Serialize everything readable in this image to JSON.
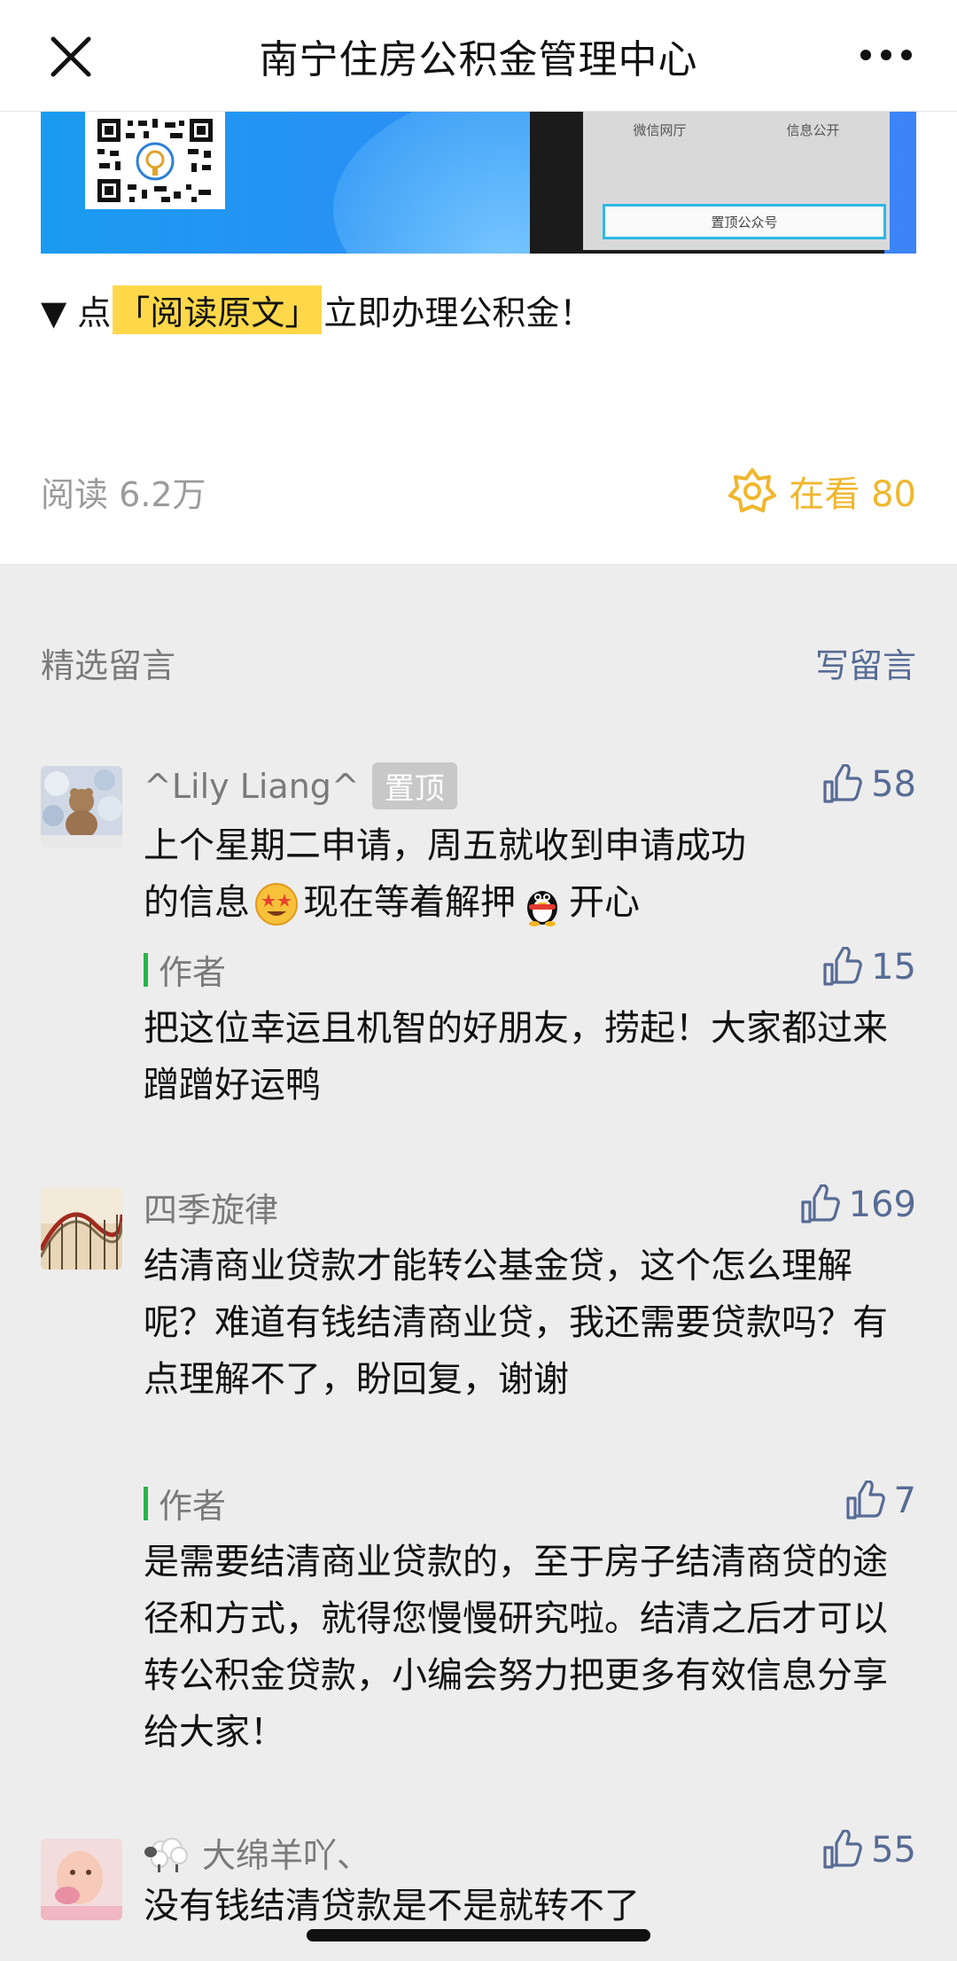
{
  "navbar": {
    "title": "南宁住房公积金管理中心",
    "close_icon": "close-icon",
    "more_icon": "more-dots-icon"
  },
  "banner": {
    "phone_tab_1": "微信网厅",
    "phone_tab_2": "信息公开",
    "phone_button": "置顶公众号"
  },
  "article": {
    "read_prefix": "▼ 点",
    "read_link": "「阅读原文」",
    "read_suffix": "立即办理公积金！",
    "read_count": "阅读 6.2万",
    "looking_label": "在看 80"
  },
  "comments_header": {
    "title": "精选留言",
    "write": "写留言"
  },
  "comments": [
    {
      "name": "^Lily Liang^",
      "pinned_label": "置顶",
      "likes": "58",
      "text_1": "上个星期二申请，周五就收到申请成功",
      "text_2a": "的信息",
      "text_2b": "现在等着解押",
      "text_2c": "开心",
      "reply_author": "作者",
      "reply_likes": "15",
      "reply_text": "把这位幸运且机智的好朋友，捞起！大家都过来蹭蹭好运鸭"
    },
    {
      "name": "四季旋律",
      "likes": "169",
      "text": "结清商业贷款才能转公基金贷，这个怎么理解呢？难道有钱结清商业贷，我还需要贷款吗？有点理解不了，盼回复，谢谢",
      "reply_author": "作者",
      "reply_likes": "7",
      "reply_text": "是需要结清商业贷款的，至于房子结清商贷的途径和方式，就得您慢慢研究啦。结清之后才可以转公积金贷款，小编会努力把更多有效信息分享给大家！"
    },
    {
      "name": "大绵羊吖、",
      "likes": "55",
      "text": "没有钱结清贷款是不是就转不了"
    }
  ],
  "colors": {
    "link_blue": "#576b95",
    "gold": "#f0b72d",
    "author_green": "#2bb24c",
    "highlight_yellow": "#ffd84a"
  }
}
